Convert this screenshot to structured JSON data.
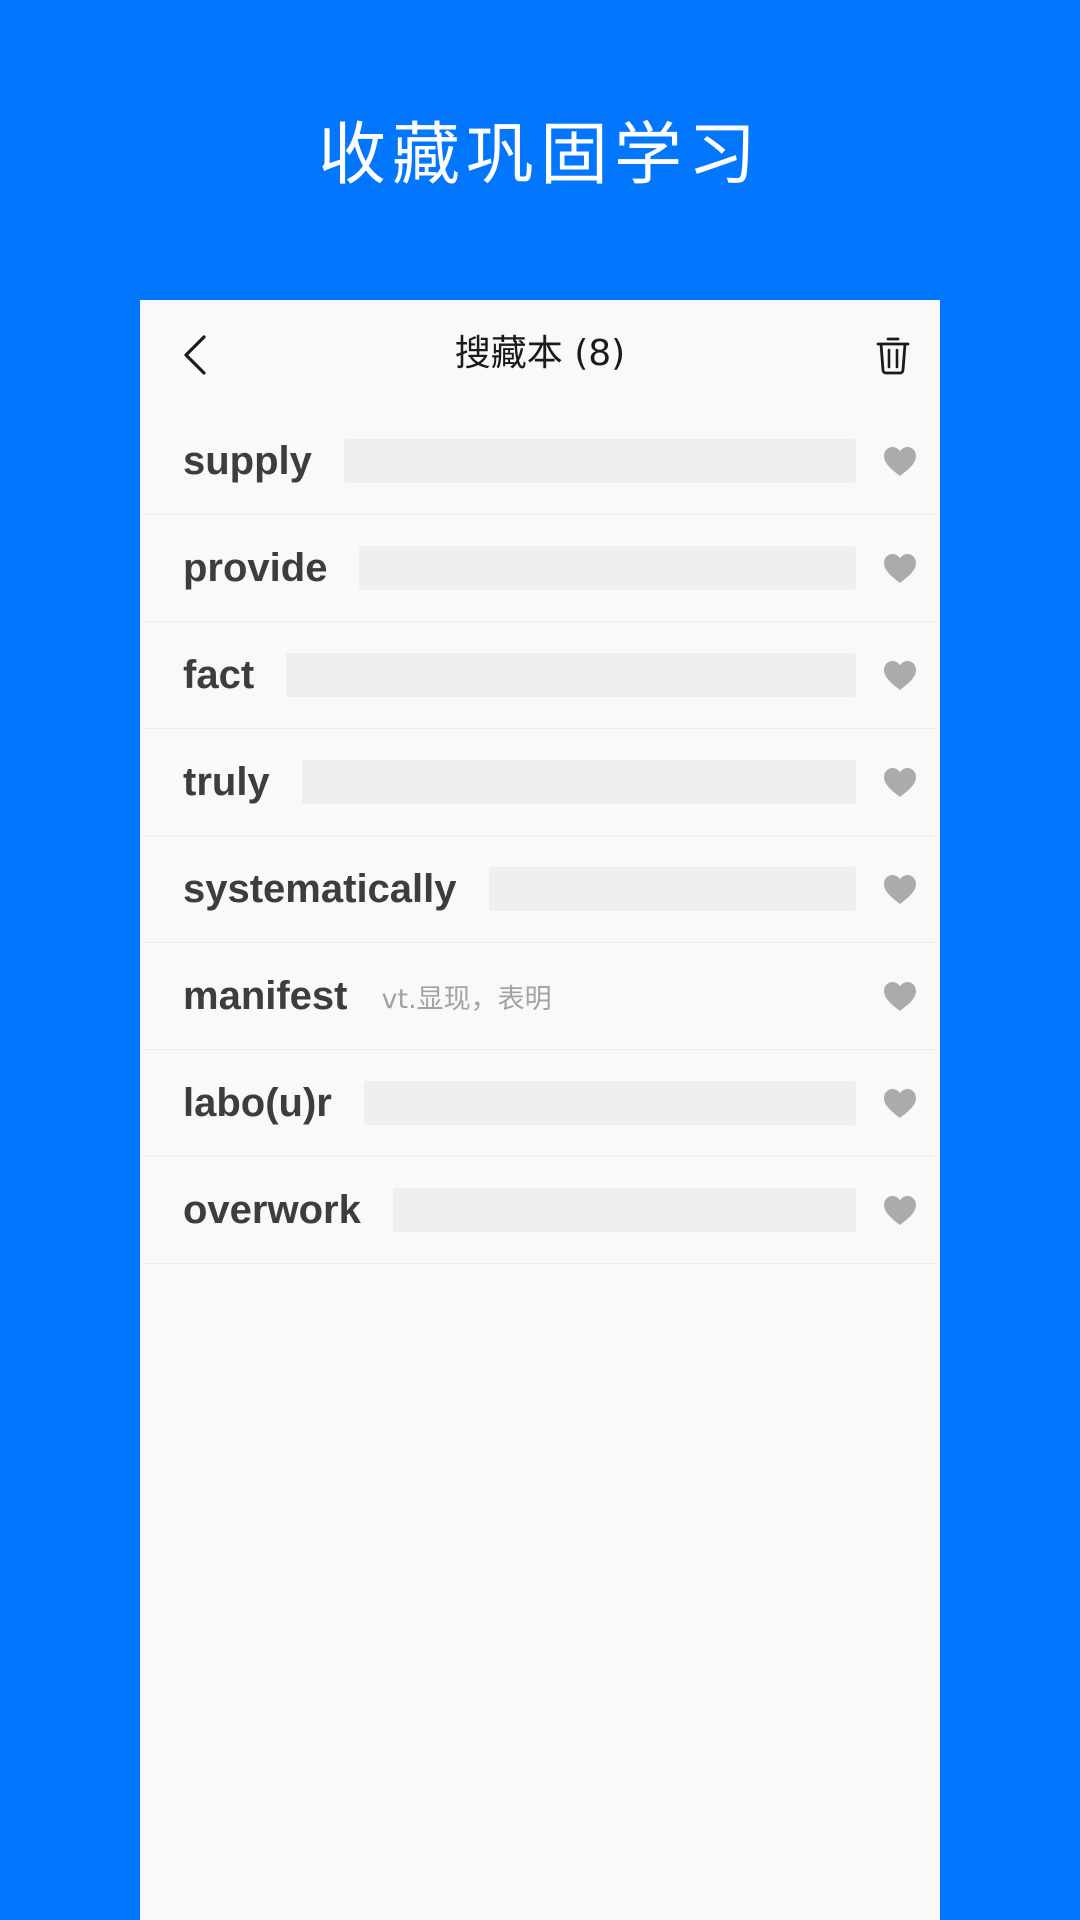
{
  "promo": {
    "title": "收藏巩固学习"
  },
  "nav": {
    "title": "搜藏本 (8)",
    "back_icon": "chevron-left-icon",
    "trash_icon": "trash-icon"
  },
  "words": [
    {
      "word": "supply",
      "meaning": "",
      "revealed": false
    },
    {
      "word": "provide",
      "meaning": "",
      "revealed": false
    },
    {
      "word": "fact",
      "meaning": "",
      "revealed": false
    },
    {
      "word": "truly",
      "meaning": "",
      "revealed": false
    },
    {
      "word": "systematically",
      "meaning": "",
      "revealed": false
    },
    {
      "word": "manifest",
      "meaning": "vt.显现，表明",
      "revealed": true
    },
    {
      "word": "labo(u)r",
      "meaning": "",
      "revealed": false
    },
    {
      "word": "overwork",
      "meaning": "",
      "revealed": false
    }
  ],
  "colors": {
    "background": "#0277FE",
    "screen": "#F9F9F9",
    "mask": "#EFEFEF",
    "heart": "#ABABAB",
    "word": "#3D3D3D"
  }
}
